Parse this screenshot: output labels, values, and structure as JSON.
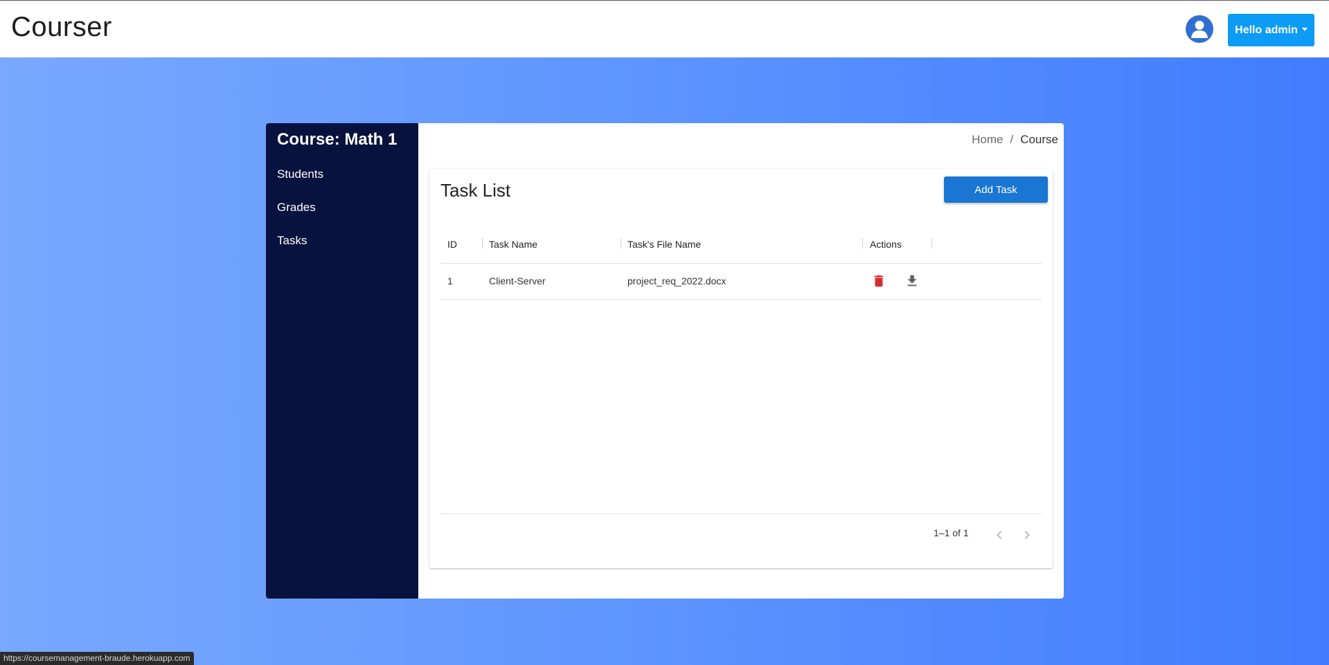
{
  "app": {
    "brand": "Courser"
  },
  "header": {
    "user_button_label": "Hello admin"
  },
  "sidebar": {
    "course_title": "Course: Math 1",
    "items": [
      {
        "label": "Students"
      },
      {
        "label": "Grades"
      },
      {
        "label": "Tasks"
      }
    ]
  },
  "breadcrumb": {
    "home": "Home",
    "separator": "/",
    "current": "Course"
  },
  "task_list": {
    "title": "Task List",
    "add_button_label": "Add Task",
    "columns": [
      "ID",
      "Task Name",
      "Task's File Name",
      "Actions"
    ],
    "rows": [
      {
        "id": "1",
        "task_name": "Client-Server",
        "file_name": "project_req_2022.docx"
      }
    ],
    "pagination": "1–1 of 1"
  },
  "status_bar": {
    "url": "https://coursemanagement-braude.herokuapp.com"
  },
  "colors": {
    "navbar_bg": "#ffffff",
    "sidebar_bg": "#08123e",
    "primary_button": "#1976d2",
    "user_button": "#0d9cf5",
    "delete_icon": "#d32f2f",
    "download_icon": "#616161"
  },
  "icons": {
    "avatar": "user-circle-icon",
    "delete": "trash-icon",
    "download": "download-icon",
    "prev": "chevron-left-icon",
    "next": "chevron-right-icon"
  }
}
